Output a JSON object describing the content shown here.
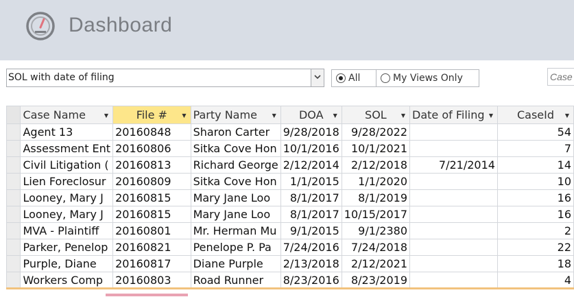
{
  "header": {
    "title": "Dashboard",
    "logo_icon": "gauge-icon"
  },
  "view": {
    "selected": "SOL with date of filing",
    "options": [
      {
        "label": "All",
        "checked": true
      },
      {
        "label": "My Views Only",
        "checked": false
      }
    ]
  },
  "search": {
    "placeholder": "Case"
  },
  "grid": {
    "columns": [
      "Case Name",
      "File #",
      "Party Name",
      "DOA",
      "SOL",
      "Date of Filing",
      "CaseId"
    ],
    "rows": [
      [
        "Agent 13",
        "20160848",
        "Sharon Carter",
        "9/28/2018",
        "9/28/2022",
        "",
        "54"
      ],
      [
        "Assessment Ent",
        "20160806",
        "Sitka Cove Hon",
        "10/1/2016",
        "10/1/2021",
        "",
        "7"
      ],
      [
        "Civil Litigation (",
        "20160813",
        "Richard George",
        "2/12/2014",
        "2/12/2018",
        "7/21/2014",
        "14"
      ],
      [
        "Lien Foreclosur",
        "20160809",
        "Sitka Cove Hon",
        "1/1/2015",
        "1/1/2020",
        "",
        "10"
      ],
      [
        "Looney, Mary J",
        "20160815",
        "Mary  Jane Loo",
        "8/1/2017",
        "8/1/2019",
        "",
        "16"
      ],
      [
        "Looney, Mary J",
        "20160815",
        "Mary  Jane Loo",
        "8/1/2017",
        "10/15/2017",
        "",
        "16"
      ],
      [
        "MVA - Plaintiff",
        "20160801",
        "Mr. Herman Mu",
        "9/1/2015",
        "9/1/2380",
        "",
        "2"
      ],
      [
        "Parker, Penelop",
        "20160821",
        "Penelope P. Pa",
        "7/24/2016",
        "7/24/2018",
        "",
        "22"
      ],
      [
        "Purple, Diane",
        "20160817",
        "Diane Purple",
        "2/13/2018",
        "2/12/2021",
        "",
        "18"
      ],
      [
        "Workers Comp",
        "20160803",
        "Road Runner",
        "8/23/2016",
        "8/23/2019",
        "",
        "4"
      ]
    ]
  }
}
